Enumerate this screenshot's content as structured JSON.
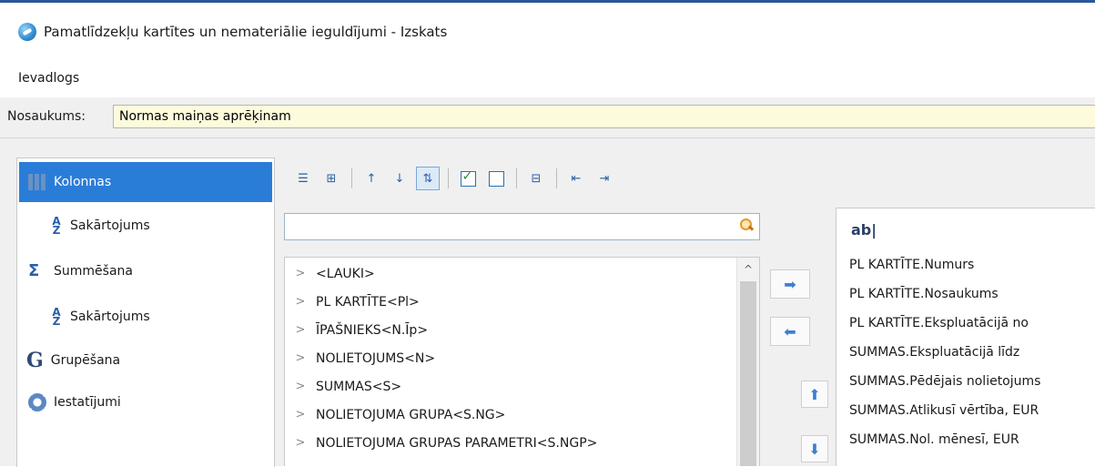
{
  "window": {
    "title": "Pamatlīdzekļu kartītes un nemateriālie ieguldījumi - Izskats"
  },
  "subtitle": "Ievadlogs",
  "name_field": {
    "label": "Nosaukums:",
    "value": "Normas maiņas aprēķinam"
  },
  "sidebar": {
    "items": [
      {
        "label": "Kolonnas",
        "icon": "columns-icon",
        "selected": true
      },
      {
        "label": "Sakārtojums",
        "icon": "sort-az-icon"
      },
      {
        "label": "Summēšana",
        "icon": "sum-icon"
      },
      {
        "label": "Sakārtojums",
        "icon": "sort-az-icon"
      },
      {
        "label": "Grupēšana",
        "icon": "group-icon"
      },
      {
        "label": "Iestatījumi",
        "icon": "gear-icon"
      }
    ]
  },
  "toolbar": {
    "icons": [
      "list-numbered-icon",
      "tree-structure-icon",
      "sort-ascending-icon",
      "sort-descending-icon",
      "sort-toggle-icon",
      "check-all-icon",
      "uncheck-all-icon",
      "tree-view-icon",
      "import-icon",
      "export-icon"
    ]
  },
  "search": {
    "value": "",
    "icon": "search-icon"
  },
  "fields_tree": {
    "items": [
      "<LAUKI>",
      "PL KARTĪTE<Pl>",
      "ĪPAŠNIEKS<N.Īp>",
      "NOLIETOJUMS<N>",
      "SUMMAS<S>",
      "NOLIETOJUMA GRUPA<S.NG>",
      "NOLIETOJUMA GRUPAS PARAMETRI<S.NGP>"
    ]
  },
  "selected_columns": {
    "header_icon": "text-field-icon",
    "items": [
      "PL KARTĪTE.Numurs",
      "PL KARTĪTE.Nosaukums",
      "PL KARTĪTE.Ekspluatācijā no",
      "SUMMAS.Ekspluatācijā līdz",
      "SUMMAS.Pēdējais nolietojums",
      "SUMMAS.Atlikusī vērtība, EUR",
      "SUMMAS.Nol. mēnesī, EUR"
    ]
  },
  "colors": {
    "accent": "#2a7dd7",
    "input_bg": "#fefbdd",
    "panel_bg": "#f0f0f0"
  }
}
